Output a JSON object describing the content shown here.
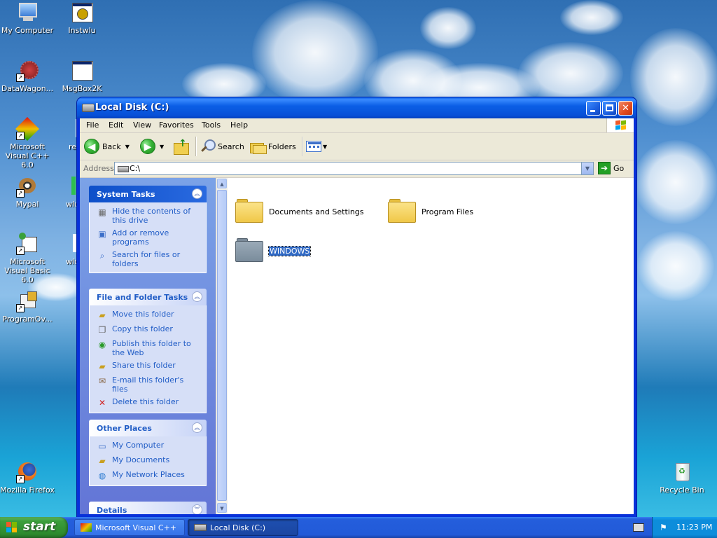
{
  "desktop": {
    "icons": [
      {
        "label": "My Computer"
      },
      {
        "label": "Instwlu"
      },
      {
        "label": "DataWagon..."
      },
      {
        "label": "MsgBox2K"
      },
      {
        "label": "Microsoft Visual C++ 6.0"
      },
      {
        "label": "re"
      },
      {
        "label": "Mypal"
      },
      {
        "label": "wlu"
      },
      {
        "label": "Microsoft Visual Basic 6.0"
      },
      {
        "label": "wlu"
      },
      {
        "label": "ProgramOv..."
      },
      {
        "label": "Mozilla Firefox"
      },
      {
        "label": "Recycle Bin"
      }
    ]
  },
  "window": {
    "title": "Local Disk (C:)",
    "menu": [
      "File",
      "Edit",
      "View",
      "Favorites",
      "Tools",
      "Help"
    ],
    "toolbar": {
      "back_label": "Back",
      "search_label": "Search",
      "folders_label": "Folders"
    },
    "address": {
      "label": "Address",
      "value": "C:\\",
      "go_label": "Go"
    },
    "task_pane": {
      "system_tasks": {
        "title": "System Tasks",
        "items": [
          "Hide the contents of this drive",
          "Add or remove programs",
          "Search for files or folders"
        ]
      },
      "file_folder_tasks": {
        "title": "File and Folder Tasks",
        "items": [
          "Move this folder",
          "Copy this folder",
          "Publish this folder to the Web",
          "Share this folder",
          "E-mail this folder's files",
          "Delete this folder"
        ]
      },
      "other_places": {
        "title": "Other Places",
        "items": [
          "My Computer",
          "My Documents",
          "My Network Places"
        ]
      },
      "details": {
        "title": "Details"
      }
    },
    "files": [
      {
        "name": "Documents and Settings",
        "selected": false
      },
      {
        "name": "Program Files",
        "selected": false
      },
      {
        "name": "WINDOWS",
        "selected": true
      }
    ]
  },
  "taskbar": {
    "start_label": "start",
    "buttons": [
      {
        "label": "Microsoft Visual C++",
        "active": false
      },
      {
        "label": "Local Disk (C:)",
        "active": true
      }
    ],
    "clock": "11:23 PM"
  },
  "colors": {
    "title_blue": "#0b5fe6",
    "link_blue": "#215dc6",
    "selection": "#316ac5",
    "folder_yellow": "#f5d463",
    "folder_gray": "#8a9aa8"
  }
}
